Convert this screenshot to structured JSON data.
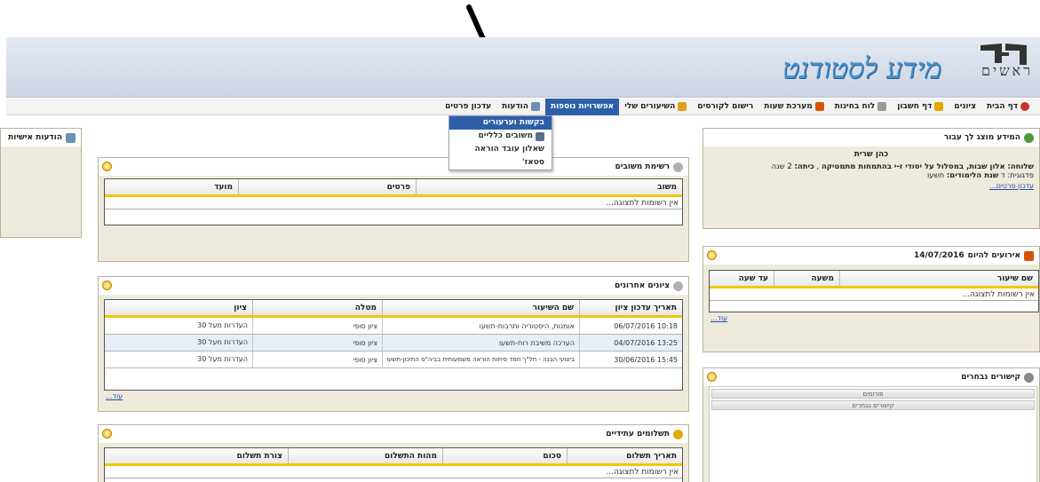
{
  "header": {
    "logo_text": "ראשים",
    "site_title": "מידע לסטודנט"
  },
  "nav": {
    "items": [
      {
        "label": "דף הבית",
        "icon": "home-icon",
        "color": "#c0392b"
      },
      {
        "label": "ציונים",
        "icon": "",
        "color": ""
      },
      {
        "label": "דף חשבון",
        "icon": "wallet-icon",
        "color": "#e6a800"
      },
      {
        "label": "לוח בחינות",
        "icon": "exam-icon",
        "color": "#8a8a8a"
      },
      {
        "label": "מערכת שעות",
        "icon": "calendar-icon",
        "color": "#d35400"
      },
      {
        "label": "רישום לקורסים",
        "icon": "",
        "color": ""
      },
      {
        "label": "השיעורים שלי",
        "icon": "notebook-icon",
        "color": "#e0a020"
      },
      {
        "label": "אפשרויות נוספות",
        "icon": "",
        "color": ""
      },
      {
        "label": "הודעות",
        "icon": "messages-icon",
        "color": "#6b8fb8"
      },
      {
        "label": "עדכון פרטים",
        "icon": "",
        "color": ""
      }
    ]
  },
  "dropdown": {
    "items": [
      {
        "label": "בקשות וערעורים"
      },
      {
        "label": "משובים כלליים"
      },
      {
        "label": "שאלון עובד הוראה"
      },
      {
        "label": "סטאז'"
      }
    ]
  },
  "personal_messages": {
    "title": "הודעות אישיות"
  },
  "info_panel": {
    "title": "המידע מוצג לך עבור",
    "name": "כהן שרית",
    "track_label": "שלוחה:",
    "track_value": "אלון שבות, במסלול על יסודי ז-י בהתמחות מתמטיקה",
    "class_label": "כיתה:",
    "class_value": "2 שנה",
    "ped_label": "פדגוגית:",
    "ped_value": "ד",
    "year_label": "שנת הלימודים:",
    "year_value": "תשעו",
    "update_link": "עדכון פרטים..."
  },
  "events_panel": {
    "title": "אירועים להיום",
    "date": "14/07/2016",
    "columns": [
      "שם שיעור",
      "משעה",
      "עד שעה"
    ],
    "empty": "אין רשומות לתצוגה...",
    "more": "עוד..."
  },
  "links_panel": {
    "title": "קישורים נבחרים",
    "items": [
      "פורומים",
      "קישורים נבחרים"
    ]
  },
  "feedback_panel": {
    "title": "רשימת משובים",
    "columns": [
      "משוב",
      "פרטים",
      "מועד"
    ],
    "empty": "אין רשומות לתצוגה..."
  },
  "grades_panel": {
    "title": "ציונים אחרונים",
    "columns": [
      "תאריך עדכון ציון",
      "שם השיעור",
      "מטלה",
      "ציון"
    ],
    "rows": [
      {
        "date": "10:18 06/07/2016",
        "course": "אומנות, היסטוריה ותרבות-תשעו",
        "task": "ציון סופי",
        "grade": "העדרות מעל 30"
      },
      {
        "date": "13:25 04/07/2016",
        "course": "הערכה משיבת רוח-תשעו",
        "task": "ציון סופי",
        "grade": "העדרות מעל 30"
      },
      {
        "date": "15:45 30/06/2016",
        "course": "ביצועי הבנה - תל\"ך חמד פיתוח הוראה משמעותית בביה\"ס התיכון-תשעו",
        "task": "ציון סופי",
        "grade": "העדרות מעל 30"
      }
    ],
    "more": "עוד..."
  },
  "payments_panel": {
    "title": "תשלומים עתידיים",
    "columns": [
      "תאריך תשלום",
      "סכום",
      "מהות התשלום",
      "צורת תשלום"
    ],
    "empty": "אין רשומות לתצוגה..."
  }
}
